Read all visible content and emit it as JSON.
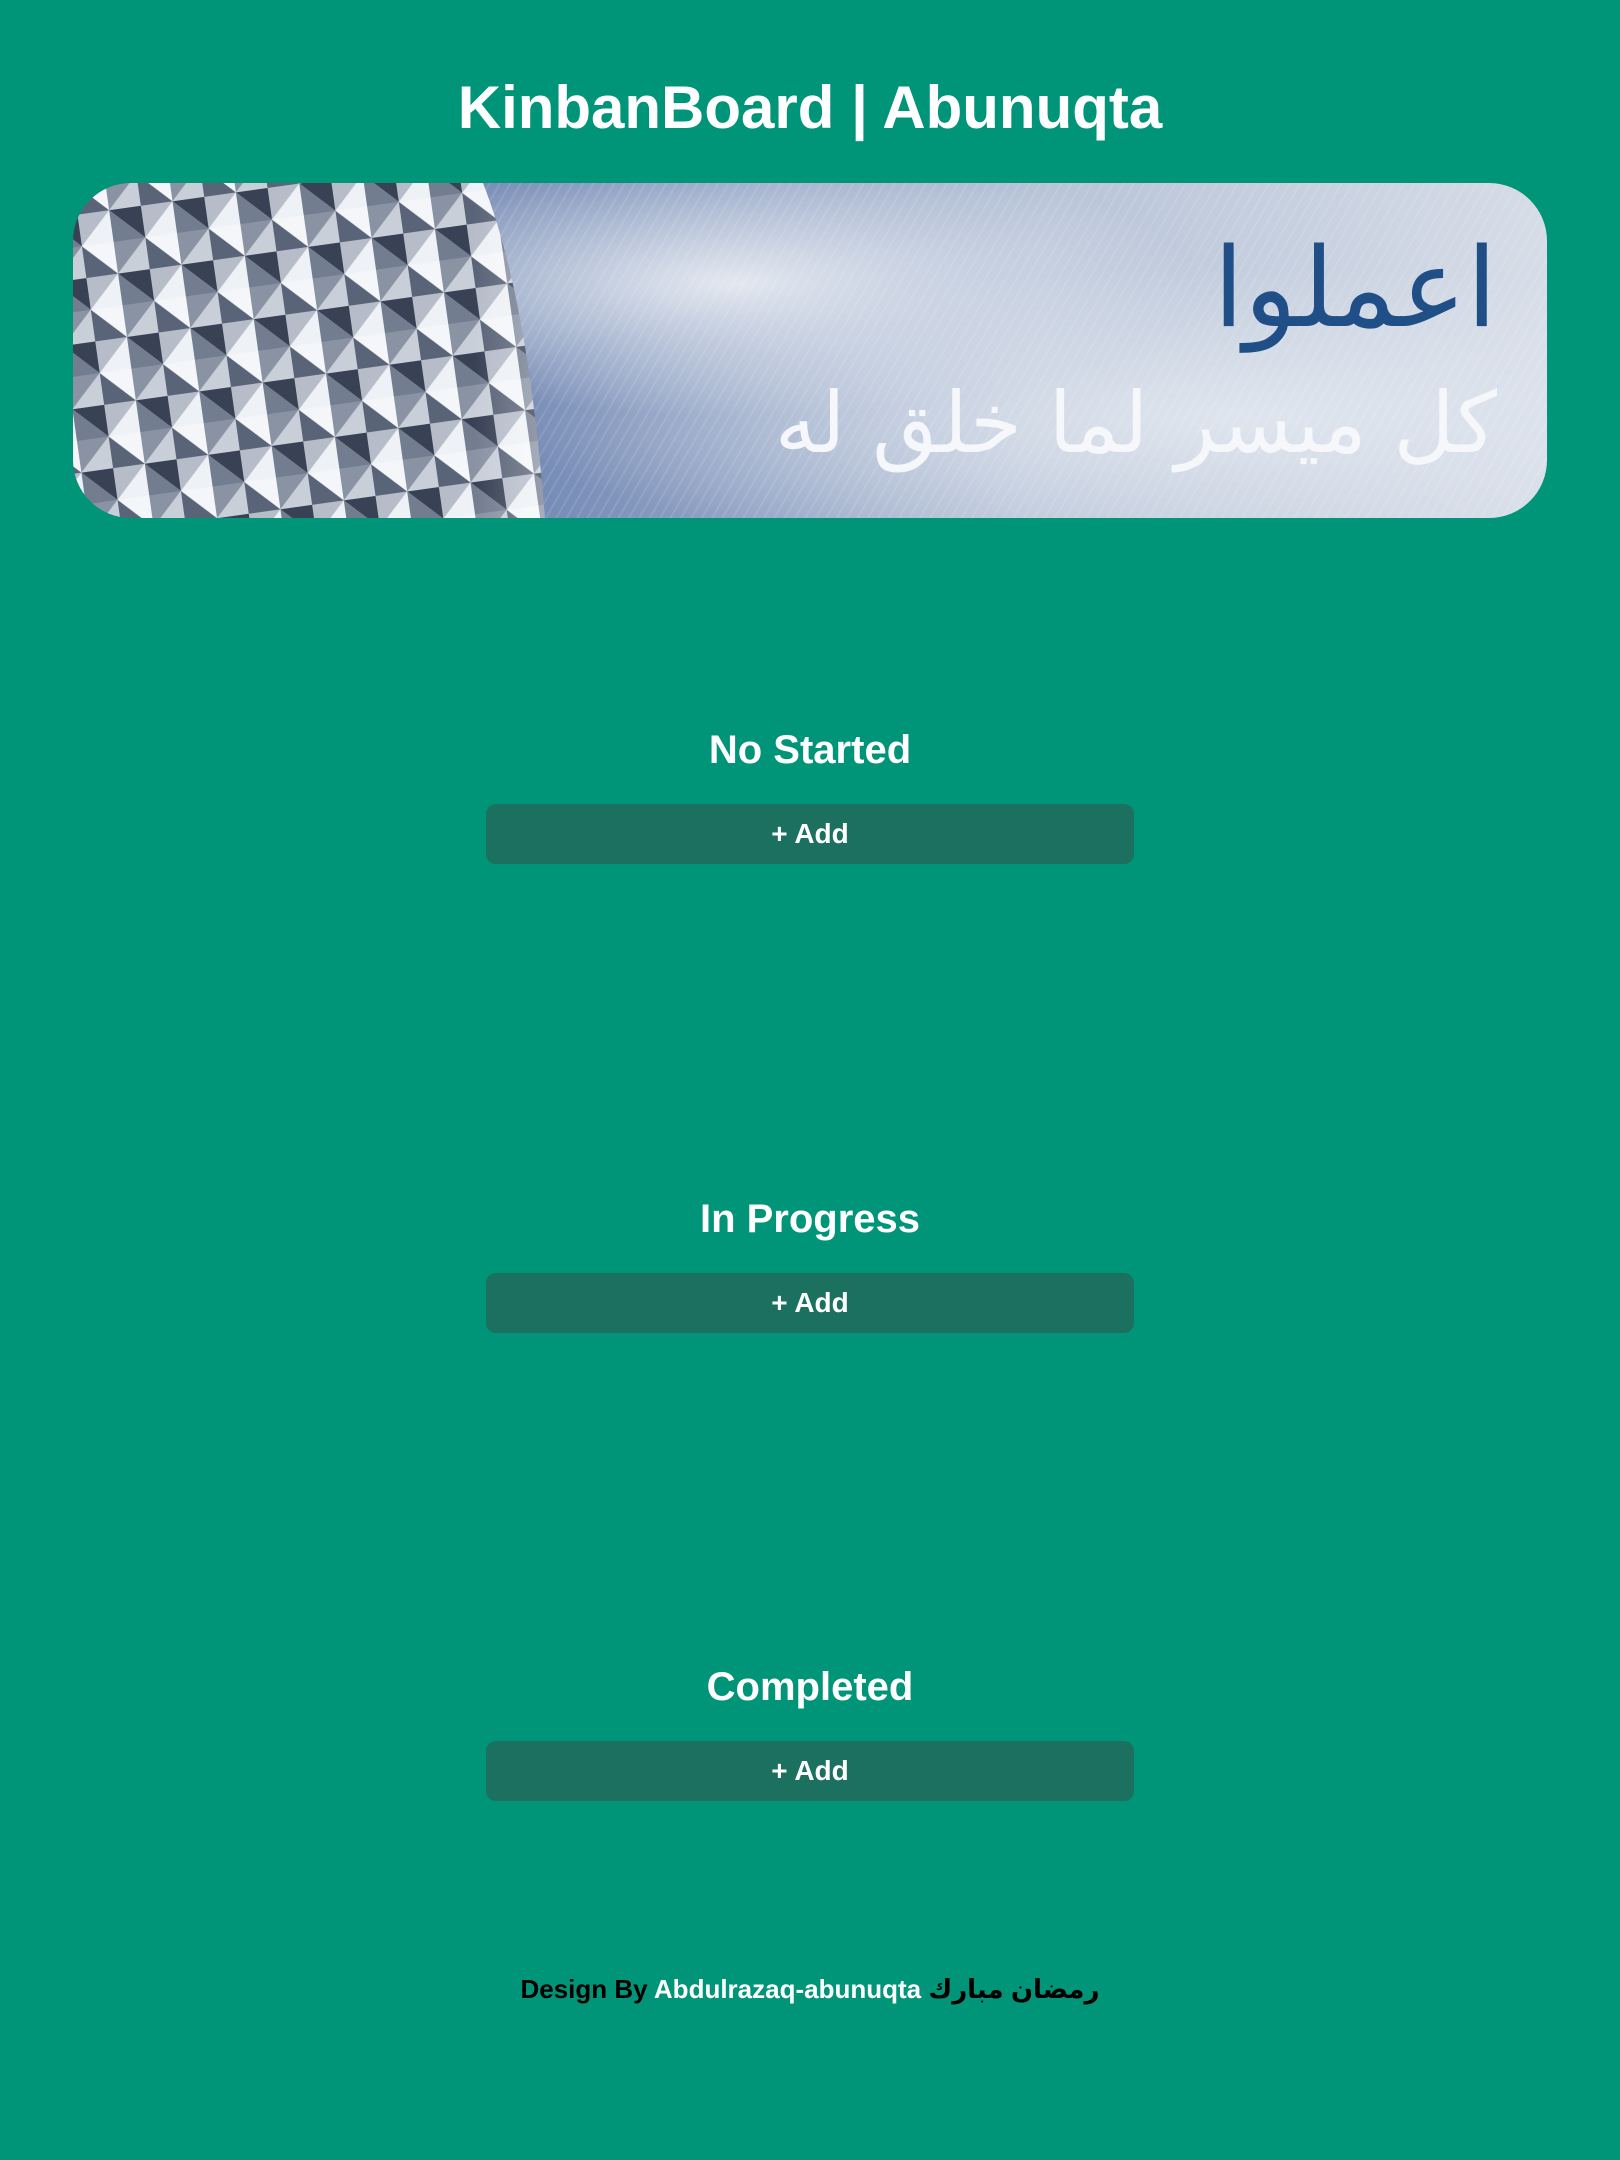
{
  "header": {
    "title": "KinbanBoard | Abunuqta"
  },
  "banner": {
    "line1": "اعملوا",
    "line2": "كل ميسر لما خلق له"
  },
  "columns": [
    {
      "title": "No Started",
      "add_label": "+ Add"
    },
    {
      "title": "In Progress",
      "add_label": "+ Add"
    },
    {
      "title": "Completed",
      "add_label": "+ Add"
    }
  ],
  "footer": {
    "prefix": "Design By",
    "author": "Abdulrazaq-abunuqta",
    "greeting": "رمضان مبارك"
  },
  "colors": {
    "background": "#009578",
    "button": "#1b705f",
    "text": "#ffffff",
    "footer_text": "#000000"
  }
}
